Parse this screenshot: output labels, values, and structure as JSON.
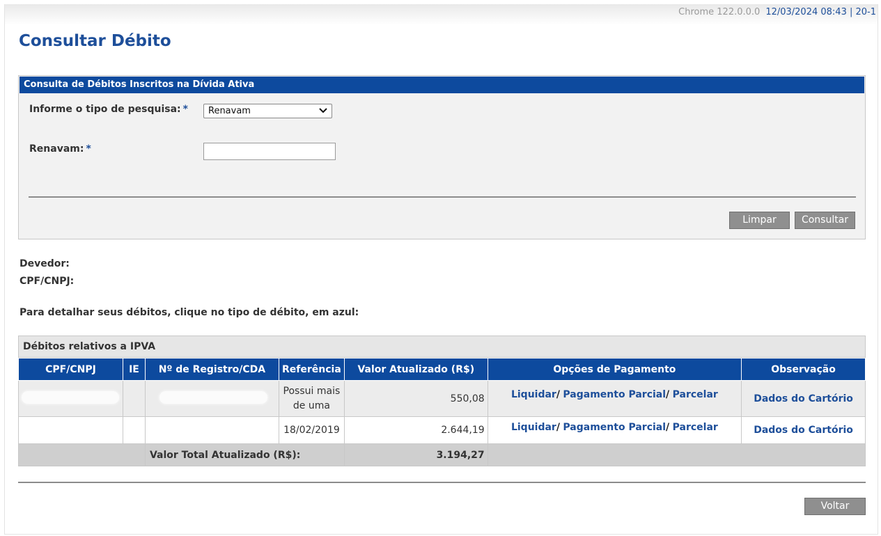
{
  "topbar": {
    "browser": "Chrome 122.0.0.0",
    "datetime": "12/03/2024 08:43 | 20-1"
  },
  "page_title": "Consultar Débito",
  "panel": {
    "title": "Consulta de Débitos Inscritos na Dívida Ativa",
    "search_type_label": "Informe o tipo de pesquisa:",
    "required_mark": "*",
    "search_type_value": "Renavam",
    "renavam_label": "Renavam:",
    "renavam_value": "",
    "clear_button": "Limpar",
    "submit_button": "Consultar"
  },
  "debtor": {
    "devedor_label": "Devedor:",
    "cpf_label": "CPF/CNPJ:"
  },
  "instructions": "Para detalhar seus débitos, clique no tipo de débito, em azul:",
  "debts": {
    "section_title": "Débitos relativos a IPVA",
    "columns": [
      "CPF/CNPJ",
      "IE",
      "Nº de Registro/CDA",
      "Referência",
      "Valor Atualizado (R$)",
      "Opções de Pagamento",
      "Observação"
    ],
    "rows": [
      {
        "reference": "Possui mais de uma",
        "value": "550,08",
        "opt1": "Liquidar",
        "opt2": "Pagamento Parcial",
        "opt3": "Parcelar",
        "obs": "Dados do Cartório",
        "sep": "/"
      },
      {
        "reference": "18/02/2019",
        "value": "2.644,19",
        "opt1": "Liquidar",
        "opt2": "Pagamento Parcial",
        "opt3": "Parcelar",
        "obs": "Dados do Cartório",
        "sep": "/"
      }
    ],
    "total_label": "Valor Total Atualizado (R$):",
    "total_value": "3.194,27"
  },
  "back_button": "Voltar",
  "colors": {
    "header_blue": "#0d4a9e",
    "link_blue": "#1e4f9a",
    "button_gray": "#8f8f8f"
  }
}
